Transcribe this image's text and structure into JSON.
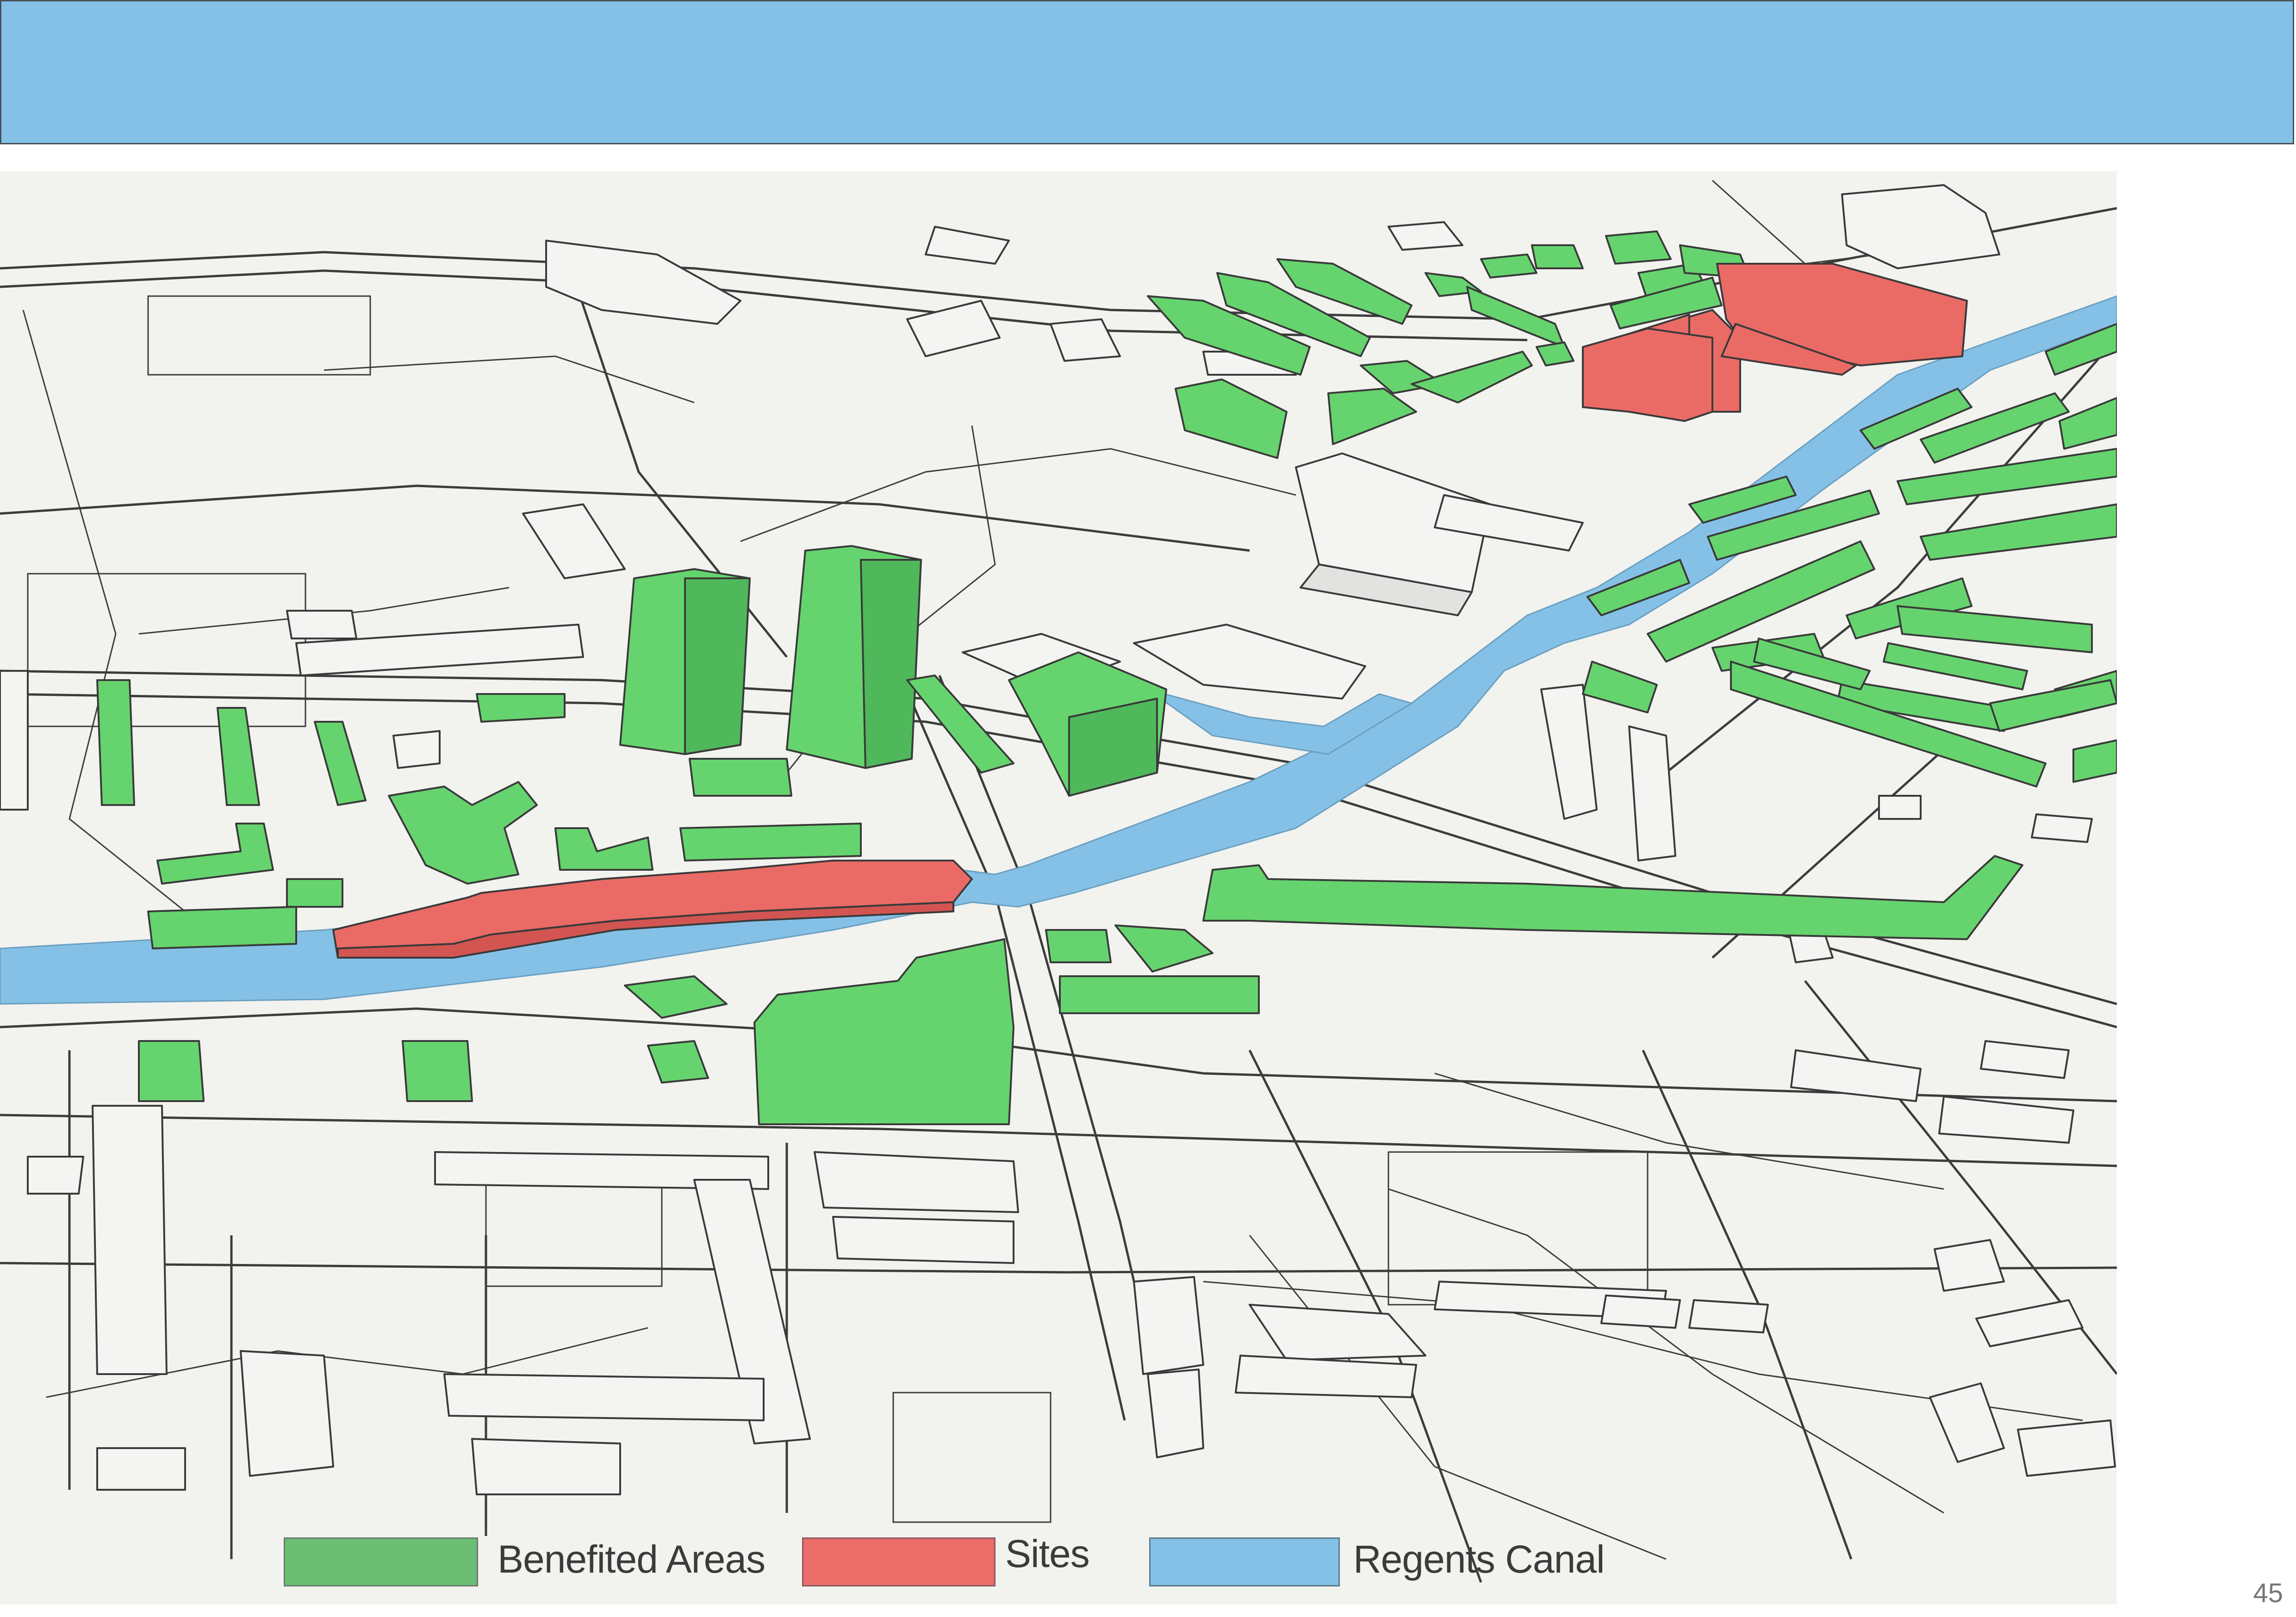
{
  "header": {
    "title": ""
  },
  "map": {
    "alt": "3D isometric massing model of area along the canal",
    "colors": {
      "benefited_areas": "#66d46e",
      "sites": "#ea6a66",
      "regents_canal": "#85c1e7",
      "background": "#f2f2ef"
    }
  },
  "legend": {
    "items": [
      {
        "label": "Benefited Areas",
        "color": "#6bbf74"
      },
      {
        "label": "Sites",
        "color": "#ec6c6a"
      },
      {
        "label": "Regents Canal",
        "color": "#85c1e7"
      }
    ]
  },
  "page_number": "45"
}
